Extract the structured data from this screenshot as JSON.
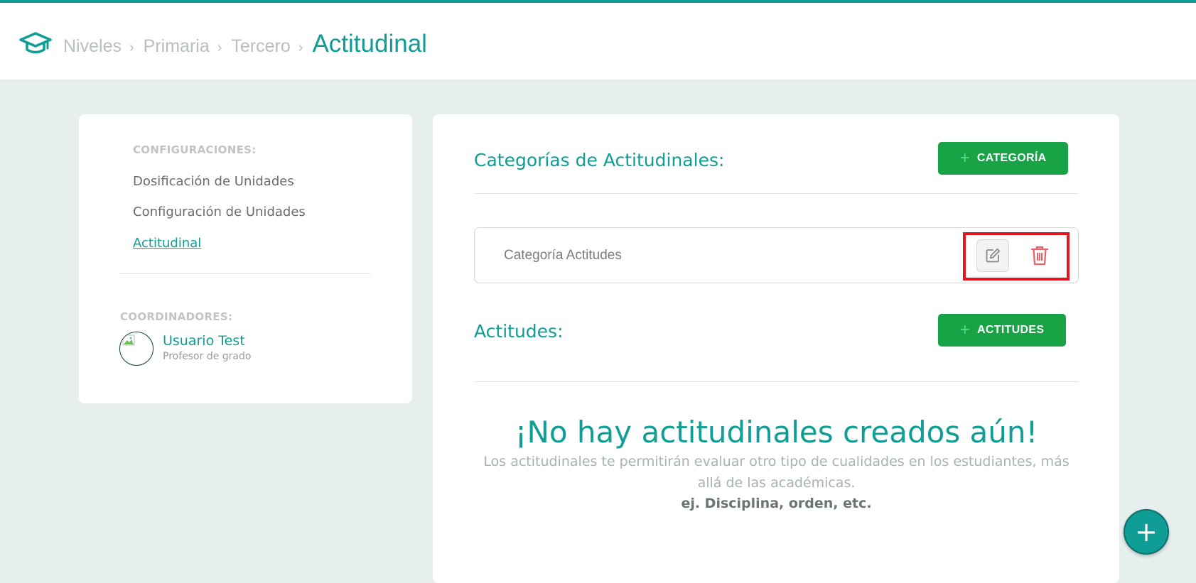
{
  "colors": {
    "accent": "#0f9d96",
    "button_green": "#17a346",
    "delete_red": "#e8606a",
    "highlight_red": "#e5141c",
    "background": "#e7eeee"
  },
  "breadcrumb": {
    "icon": "graduation-cap-icon",
    "items": [
      "Niveles",
      "Primaria",
      "Tercero"
    ],
    "separator": "›",
    "current": "Actitudinal"
  },
  "sidebar": {
    "config_heading": "CONFIGURACIONES:",
    "links": [
      {
        "label": "Dosificación de Unidades"
      },
      {
        "label": "Configuración de Unidades"
      },
      {
        "label": "Actitudinal",
        "active": true
      }
    ],
    "coord_heading": "COORDINADORES:",
    "coordinator": {
      "name": "Usuario Test",
      "role": "Profesor de grado"
    }
  },
  "main": {
    "categories_title": "Categorías de Actitudinales:",
    "add_category_label": "CATEGORÍA",
    "category_name": "Categoría Actitudes",
    "attitudes_title": "Actitudes:",
    "add_attitudes_label": "ACTITUDES",
    "empty": {
      "title": "¡No hay actitudinales creados aún!",
      "description": "Los actitudinales te permitirán evaluar otro tipo de cualidades en los estudiantes, más allá de las académicas.",
      "example": "ej. Disciplina, orden, etc."
    }
  },
  "fab_label": "+"
}
